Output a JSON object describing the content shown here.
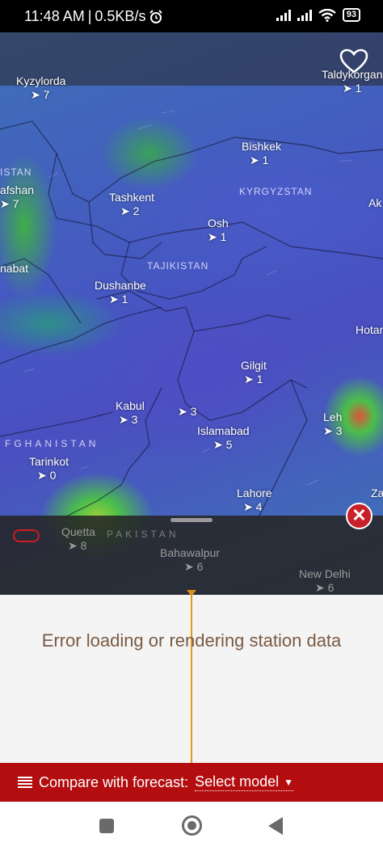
{
  "status_bar": {
    "time": "11:48 AM",
    "speed": "0.5KB/s",
    "battery": "93"
  },
  "map": {
    "cities": [
      {
        "name": "Kyzylorda",
        "wind": "7",
        "dim": false
      },
      {
        "name": "Taldykorgan",
        "wind": "1",
        "dim": false
      },
      {
        "name": "Bishkek",
        "wind": "1",
        "dim": false
      },
      {
        "name": "afshan",
        "wind": "7",
        "dim": false
      },
      {
        "name": "Tashkent",
        "wind": "2",
        "dim": false
      },
      {
        "name": "Ak",
        "wind": "",
        "dim": false
      },
      {
        "name": "Osh",
        "wind": "1",
        "dim": false
      },
      {
        "name": "nabat",
        "wind": "",
        "dim": false
      },
      {
        "name": "Dushanbe",
        "wind": "1",
        "dim": false
      },
      {
        "name": "Hotan",
        "wind": "",
        "dim": false
      },
      {
        "name": "Gilgit",
        "wind": "1",
        "dim": false
      },
      {
        "name": "Kabul",
        "wind": "3",
        "dim": false
      },
      {
        "name": "",
        "wind": "3",
        "dim": false
      },
      {
        "name": "Leh",
        "wind": "3",
        "dim": false
      },
      {
        "name": "Islamabad",
        "wind": "5",
        "dim": false
      },
      {
        "name": "Tarinkot",
        "wind": "0",
        "dim": false
      },
      {
        "name": "Lahore",
        "wind": "4",
        "dim": false
      },
      {
        "name": "Za",
        "wind": "",
        "dim": false
      },
      {
        "name": "Quetta",
        "wind": "8",
        "dim": true
      },
      {
        "name": "Bahawalpur",
        "wind": "6",
        "dim": true
      },
      {
        "name": "New Delhi",
        "wind": "6",
        "dim": true
      }
    ],
    "countries": [
      "ISTAN",
      "KYRGYZSTAN",
      "TAJIKISTAN",
      "FGHANISTAN",
      "PAKISTAN"
    ]
  },
  "panel": {
    "error": "Error loading or rendering station data"
  },
  "compare_bar": {
    "label": "Compare with forecast:",
    "select": "Select model"
  },
  "colors": {
    "accent_red": "#b30d10",
    "close_red": "#c8202a",
    "timeline": "#e09a20"
  }
}
